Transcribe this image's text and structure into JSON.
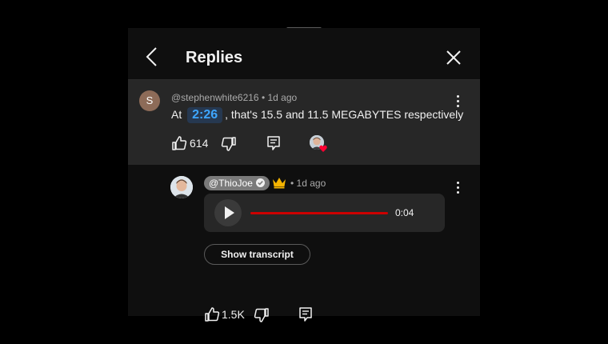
{
  "header": {
    "title": "Replies"
  },
  "parent_comment": {
    "avatar_letter": "S",
    "author": "@stephenwhite6216",
    "separator": "•",
    "time": "1d ago",
    "text_before": "At",
    "timestamp_link": "2:26",
    "text_after": ", that's 15.5 and 11.5 MEGABYTES respectively",
    "like_count": "614",
    "creator_hearted": true
  },
  "reply": {
    "author": "@ThioJoe",
    "verified": true,
    "separator": "•",
    "time": "1d ago",
    "audio_duration": "0:04",
    "transcript_button": "Show transcript",
    "like_count": "1.5K"
  },
  "colors": {
    "background": "#0f0f0f",
    "highlight_row": "#272727",
    "link_blue": "#3ea6ff",
    "progress_red": "#cc0000",
    "heart_red": "#ff0033",
    "crown_gold": "#f5b400"
  }
}
